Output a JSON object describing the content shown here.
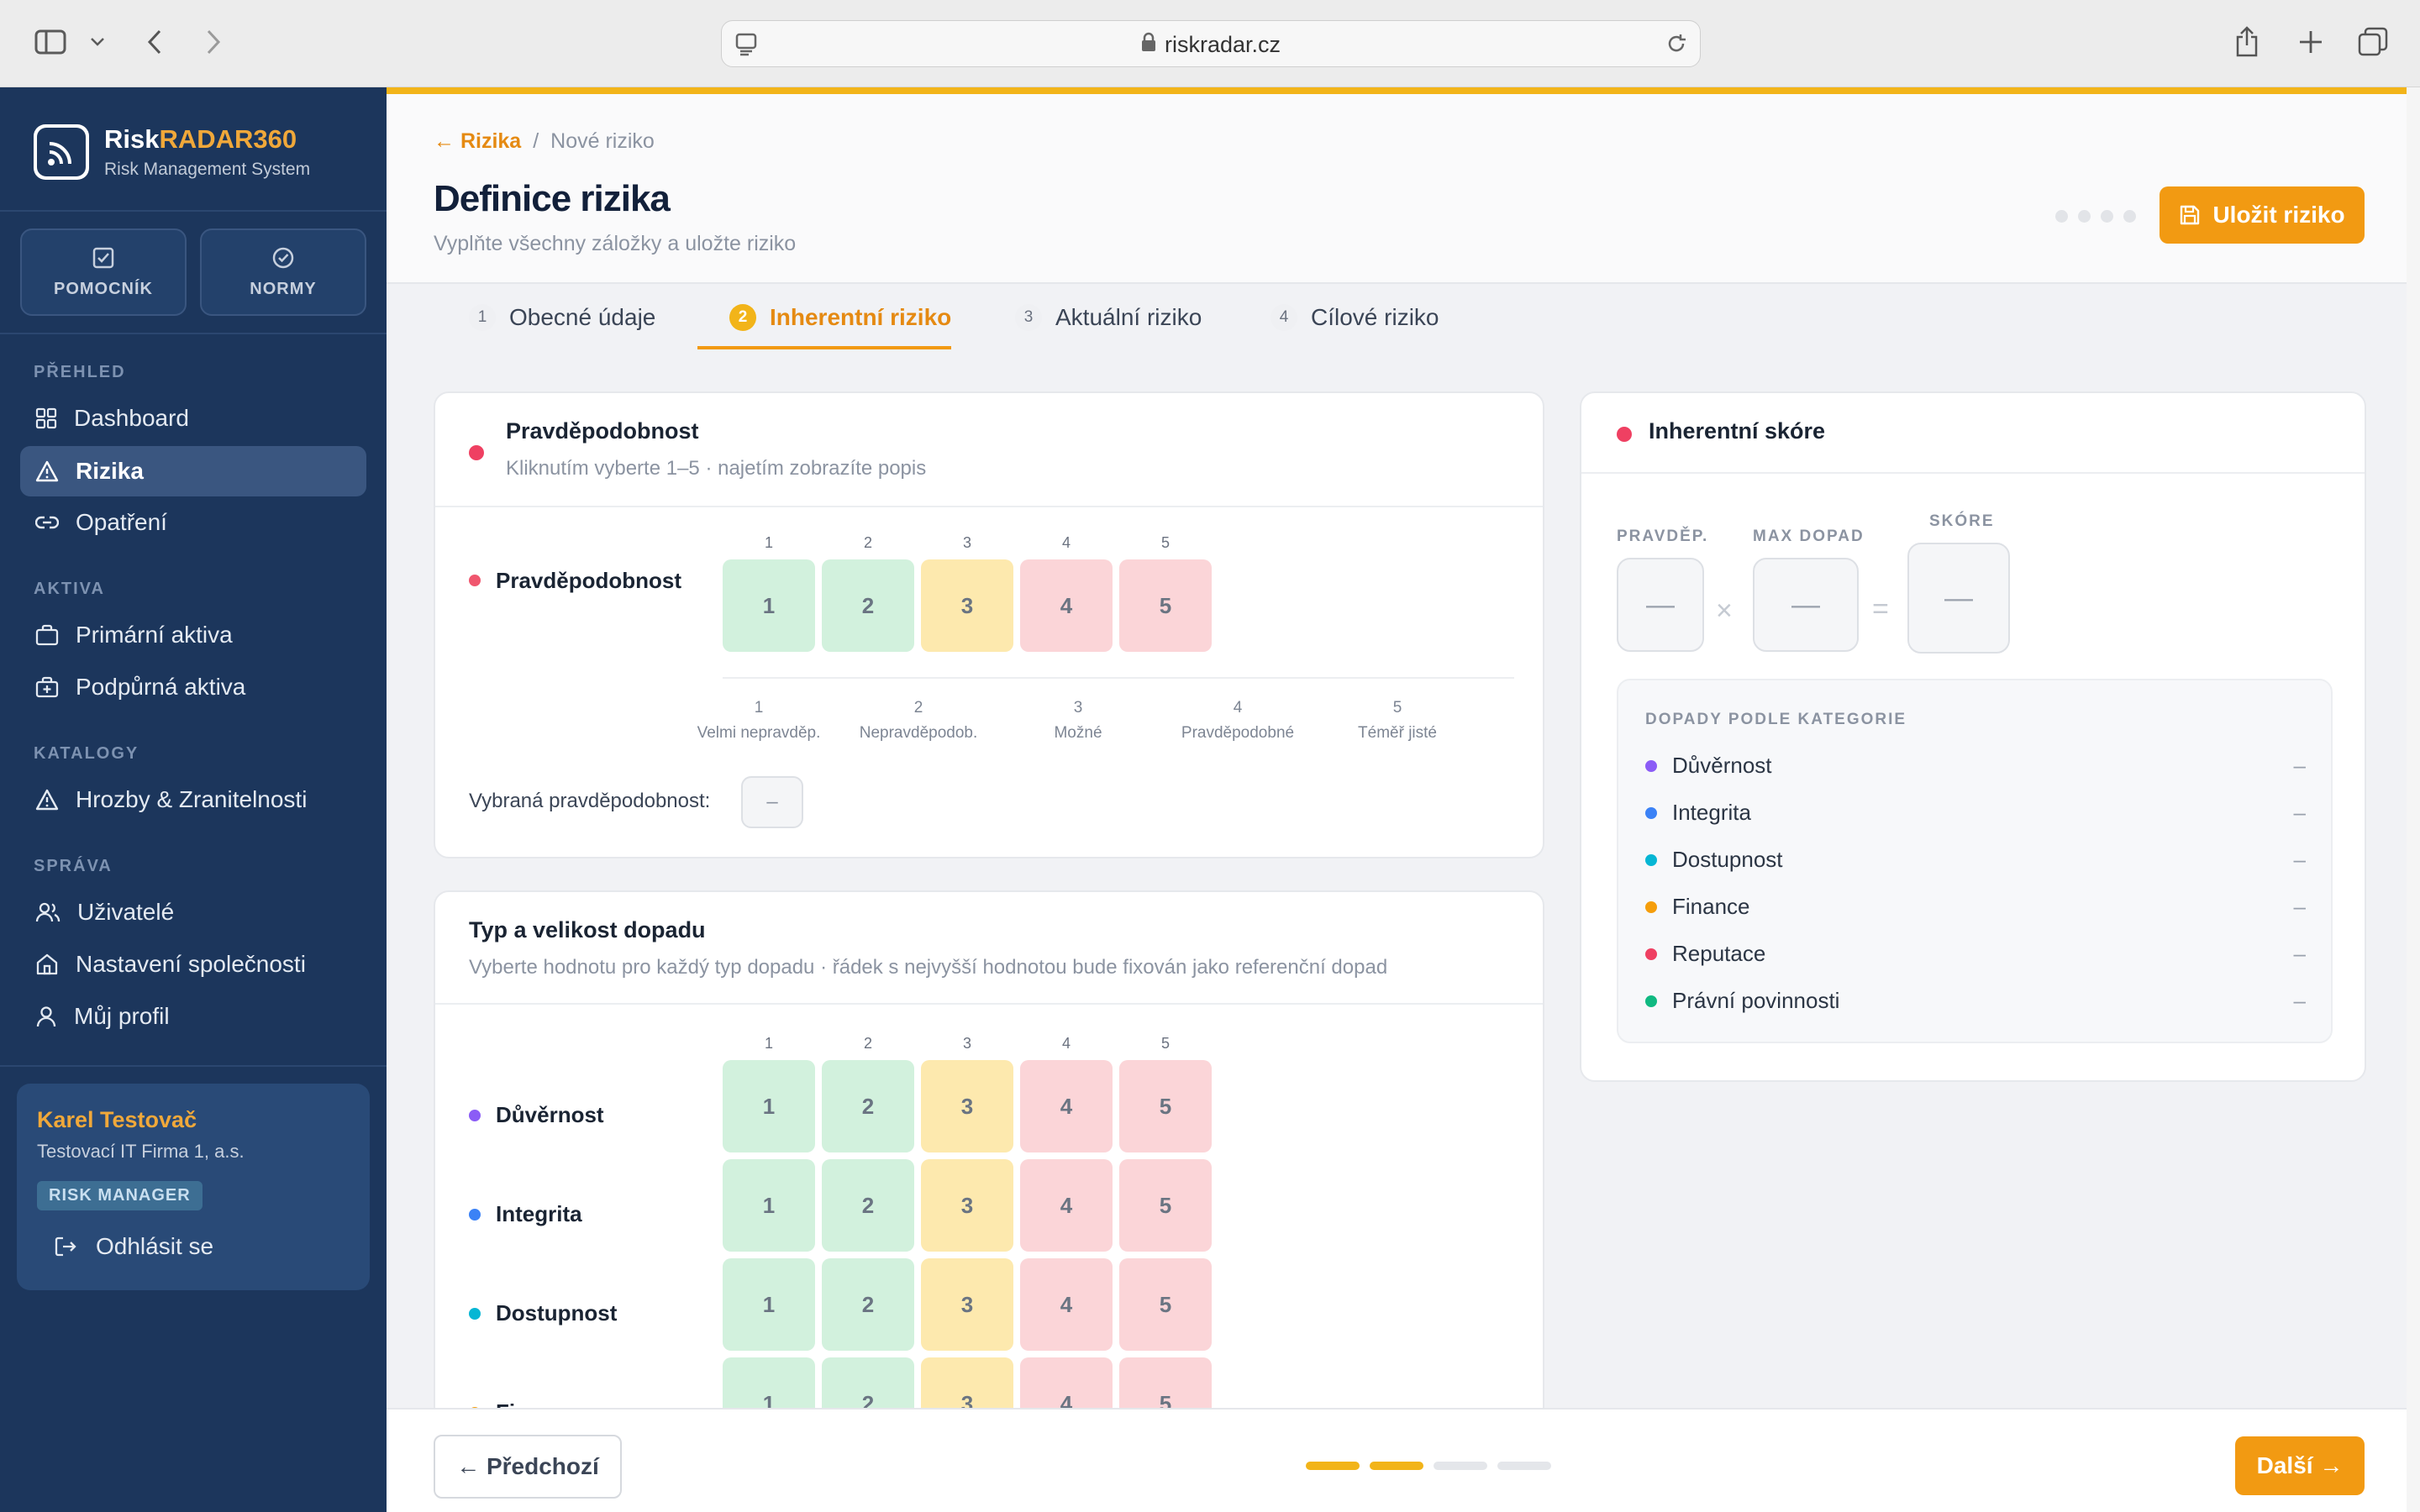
{
  "browser": {
    "url": "riskradar.cz"
  },
  "brand": {
    "name_a": "Risk",
    "name_b": "RADAR360",
    "subtitle": "Risk Management System",
    "accent": "#f0a83a"
  },
  "quick": [
    {
      "label": "POMOCNÍK",
      "icon": "check-square-icon"
    },
    {
      "label": "NORMY",
      "icon": "check-circle-icon"
    }
  ],
  "nav": {
    "sections": [
      "PŘEHLED",
      "AKTIVA",
      "KATALOGY",
      "SPRÁVA"
    ],
    "items": [
      {
        "label": "Dashboard",
        "icon": "grid-icon"
      },
      {
        "label": "Rizika",
        "icon": "warning-icon",
        "active": true
      },
      {
        "label": "Opatření",
        "icon": "link-icon"
      },
      {
        "label": "Primární aktiva",
        "icon": "briefcase-icon"
      },
      {
        "label": "Podpůrná aktiva",
        "icon": "briefcase-plus-icon"
      },
      {
        "label": "Hrozby & Zranitelnosti",
        "icon": "warning-icon"
      },
      {
        "label": "Uživatelé",
        "icon": "users-icon"
      },
      {
        "label": "Nastavení společnosti",
        "icon": "home-icon"
      },
      {
        "label": "Můj profil",
        "icon": "user-icon"
      }
    ]
  },
  "user": {
    "name": "Karel Testovač",
    "company": "Testovací IT Firma 1, a.s.",
    "role": "RISK MANAGER",
    "logout": "Odhlásit se"
  },
  "header": {
    "back": "← Rizika",
    "sep": "/",
    "crumb": "Nové riziko",
    "title": "Definice rizika",
    "subtitle": "Vyplňte všechny záložky a uložte riziko",
    "save": "Uložit riziko"
  },
  "tabs": [
    {
      "num": "1",
      "label": "Obecné údaje"
    },
    {
      "num": "2",
      "label": "Inherentní riziko",
      "active": true
    },
    {
      "num": "3",
      "label": "Aktuální riziko"
    },
    {
      "num": "4",
      "label": "Cílové riziko"
    }
  ],
  "probability": {
    "title": "Pravděpodobnost",
    "subtitle": "Kliknutím vyberte 1–5 · najetím zobrazíte popis",
    "row_label": "Pravděpodobnost",
    "levels": [
      "1",
      "2",
      "3",
      "4",
      "5"
    ],
    "scale": [
      {
        "n": "1",
        "label": "Velmi nepravděp."
      },
      {
        "n": "2",
        "label": "Nepravděpodob."
      },
      {
        "n": "3",
        "label": "Možné"
      },
      {
        "n": "4",
        "label": "Pravděpodobné"
      },
      {
        "n": "5",
        "label": "Téměř jisté"
      }
    ],
    "selected_label": "Vybraná pravděpodobnost:",
    "selected_value": "–"
  },
  "impact": {
    "title": "Typ a velikost dopadu",
    "subtitle": "Vyberte hodnotu pro každý typ dopadu · řádek s nejvyšší hodnotou bude fixován jako referenční dopad",
    "levels": [
      "1",
      "2",
      "3",
      "4",
      "5"
    ],
    "rows": [
      {
        "label": "Důvěrnost",
        "color": "#8b5cf6"
      },
      {
        "label": "Integrita",
        "color": "#3b82f6"
      },
      {
        "label": "Dostupnost",
        "color": "#06b6d4"
      },
      {
        "label": "Finance",
        "color": "#f59e0b"
      }
    ]
  },
  "score": {
    "title": "Inherentní skóre",
    "prob_label": "PRAVDĚP.",
    "impact_label": "MAX DOPAD",
    "score_label": "SKÓRE",
    "prob_value": "—",
    "impact_value": "—",
    "score_value": "—",
    "times": "×",
    "equals": "=",
    "cat_title": "DOPADY PODLE KATEGORIE",
    "categories": [
      {
        "label": "Důvěrnost",
        "color": "#8b5cf6",
        "value": "–"
      },
      {
        "label": "Integrita",
        "color": "#3b82f6",
        "value": "–"
      },
      {
        "label": "Dostupnost",
        "color": "#06b6d4",
        "value": "–"
      },
      {
        "label": "Finance",
        "color": "#f59e0b",
        "value": "–"
      },
      {
        "label": "Reputace",
        "color": "#ef4062",
        "value": "–"
      },
      {
        "label": "Právní povinnosti",
        "color": "#10b981",
        "value": "–"
      }
    ]
  },
  "footer": {
    "prev": "← Předchozí",
    "next": "Další →",
    "progress_done": 2,
    "progress_total": 4
  }
}
